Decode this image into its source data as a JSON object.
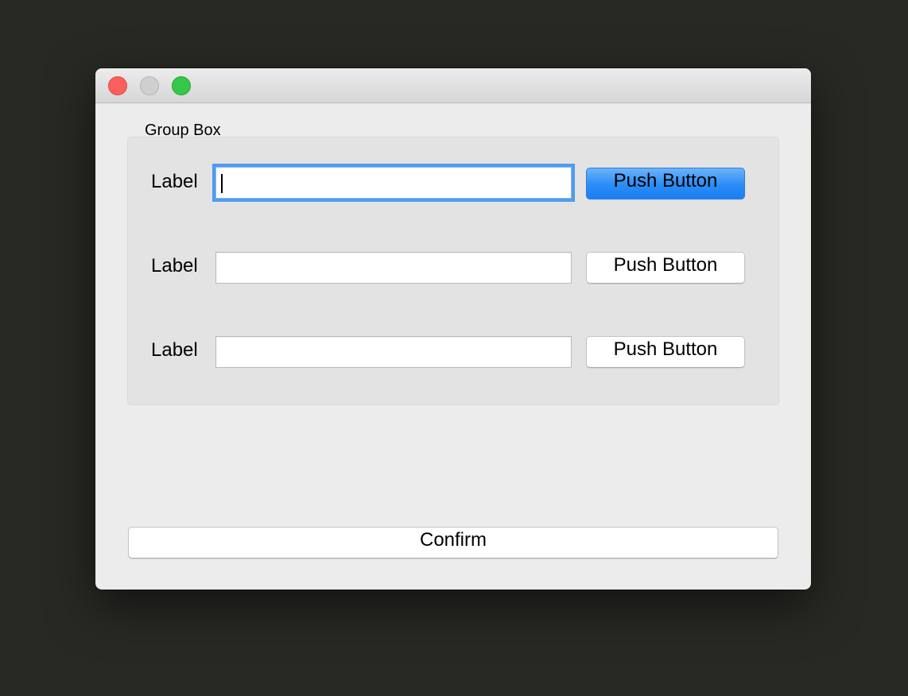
{
  "window": {
    "controls": [
      {
        "name": "close",
        "color": "#fc605c"
      },
      {
        "name": "minimize",
        "color": "#cfcfcf"
      },
      {
        "name": "zoom",
        "color": "#34c748"
      }
    ]
  },
  "group_box": {
    "title": "Group Box",
    "rows": [
      {
        "label": "Label",
        "input_value": "",
        "button_label": "Push Button",
        "focused": true,
        "default_button": true
      },
      {
        "label": "Label",
        "input_value": "",
        "button_label": "Push Button",
        "focused": false,
        "default_button": false
      },
      {
        "label": "Label",
        "input_value": "",
        "button_label": "Push Button",
        "focused": false,
        "default_button": false
      }
    ]
  },
  "footer": {
    "confirm_label": "Confirm"
  },
  "colors": {
    "focus_ring": "#4f9dee",
    "default_button": "#2a8cf6",
    "background": "#282824",
    "window": "#ececec"
  }
}
